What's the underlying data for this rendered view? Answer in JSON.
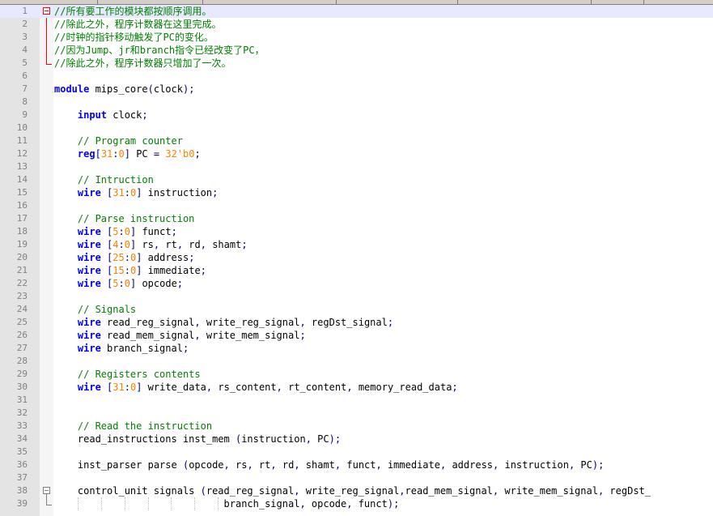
{
  "editor": {
    "fold_markers": [
      {
        "line": 1,
        "type": "minus",
        "color": "red"
      },
      {
        "line": 38,
        "type": "minus",
        "color": "gray"
      }
    ],
    "current_line": 1
  },
  "lines": [
    {
      "num": "1",
      "tokens": [
        {
          "t": "//所有要工作的模块都按顺序调用。",
          "c": "cm"
        }
      ]
    },
    {
      "num": "2",
      "tokens": [
        {
          "t": "//除此之外，程序计数器在这里完成。",
          "c": "cm"
        }
      ]
    },
    {
      "num": "3",
      "tokens": [
        {
          "t": "//时钟的指针移动触发了PC的变化。",
          "c": "cm"
        }
      ]
    },
    {
      "num": "4",
      "tokens": [
        {
          "t": "//因为Jump、jr和branch指令已经改变了PC，",
          "c": "cm"
        }
      ]
    },
    {
      "num": "5",
      "tokens": [
        {
          "t": "//除此之外，程序计数器只增加了一次。",
          "c": "cm"
        }
      ]
    },
    {
      "num": "6",
      "tokens": []
    },
    {
      "num": "7",
      "tokens": [
        {
          "t": "module",
          "c": "kw"
        },
        {
          "t": " mips_core",
          "c": ""
        },
        {
          "t": "(",
          "c": "op"
        },
        {
          "t": "clock",
          "c": ""
        },
        {
          "t": ");",
          "c": "op"
        }
      ]
    },
    {
      "num": "8",
      "tokens": []
    },
    {
      "num": "9",
      "tokens": [
        {
          "t": "    ",
          "c": ""
        },
        {
          "t": "input",
          "c": "kw"
        },
        {
          "t": " clock",
          "c": ""
        },
        {
          "t": ";",
          "c": "op"
        }
      ]
    },
    {
      "num": "10",
      "tokens": []
    },
    {
      "num": "11",
      "tokens": [
        {
          "t": "    ",
          "c": ""
        },
        {
          "t": "// Program counter",
          "c": "cm"
        }
      ]
    },
    {
      "num": "12",
      "tokens": [
        {
          "t": "    ",
          "c": ""
        },
        {
          "t": "reg",
          "c": "kw"
        },
        {
          "t": "[",
          "c": "op"
        },
        {
          "t": "31",
          "c": "num"
        },
        {
          "t": ":",
          "c": "op"
        },
        {
          "t": "0",
          "c": "num"
        },
        {
          "t": "]",
          "c": "op"
        },
        {
          "t": " PC ",
          "c": ""
        },
        {
          "t": "=",
          "c": "op"
        },
        {
          "t": " ",
          "c": ""
        },
        {
          "t": "32'b0",
          "c": "num"
        },
        {
          "t": ";",
          "c": "op"
        }
      ]
    },
    {
      "num": "13",
      "tokens": []
    },
    {
      "num": "14",
      "tokens": [
        {
          "t": "    ",
          "c": ""
        },
        {
          "t": "// Intruction",
          "c": "cm"
        }
      ]
    },
    {
      "num": "15",
      "tokens": [
        {
          "t": "    ",
          "c": ""
        },
        {
          "t": "wire",
          "c": "kw"
        },
        {
          "t": " ",
          "c": ""
        },
        {
          "t": "[",
          "c": "op"
        },
        {
          "t": "31",
          "c": "num"
        },
        {
          "t": ":",
          "c": "op"
        },
        {
          "t": "0",
          "c": "num"
        },
        {
          "t": "]",
          "c": "op"
        },
        {
          "t": " instruction",
          "c": ""
        },
        {
          "t": ";",
          "c": "op"
        }
      ]
    },
    {
      "num": "16",
      "tokens": []
    },
    {
      "num": "17",
      "tokens": [
        {
          "t": "    ",
          "c": ""
        },
        {
          "t": "// Parse instruction",
          "c": "cm"
        }
      ]
    },
    {
      "num": "18",
      "tokens": [
        {
          "t": "    ",
          "c": ""
        },
        {
          "t": "wire",
          "c": "kw"
        },
        {
          "t": " ",
          "c": ""
        },
        {
          "t": "[",
          "c": "op"
        },
        {
          "t": "5",
          "c": "num"
        },
        {
          "t": ":",
          "c": "op"
        },
        {
          "t": "0",
          "c": "num"
        },
        {
          "t": "]",
          "c": "op"
        },
        {
          "t": " funct",
          "c": ""
        },
        {
          "t": ";",
          "c": "op"
        }
      ]
    },
    {
      "num": "19",
      "tokens": [
        {
          "t": "    ",
          "c": ""
        },
        {
          "t": "wire",
          "c": "kw"
        },
        {
          "t": " ",
          "c": ""
        },
        {
          "t": "[",
          "c": "op"
        },
        {
          "t": "4",
          "c": "num"
        },
        {
          "t": ":",
          "c": "op"
        },
        {
          "t": "0",
          "c": "num"
        },
        {
          "t": "]",
          "c": "op"
        },
        {
          "t": " rs",
          "c": ""
        },
        {
          "t": ",",
          "c": "op"
        },
        {
          "t": " rt",
          "c": ""
        },
        {
          "t": ",",
          "c": "op"
        },
        {
          "t": " rd",
          "c": ""
        },
        {
          "t": ",",
          "c": "op"
        },
        {
          "t": " shamt",
          "c": ""
        },
        {
          "t": ";",
          "c": "op"
        }
      ]
    },
    {
      "num": "20",
      "tokens": [
        {
          "t": "    ",
          "c": ""
        },
        {
          "t": "wire",
          "c": "kw"
        },
        {
          "t": " ",
          "c": ""
        },
        {
          "t": "[",
          "c": "op"
        },
        {
          "t": "25",
          "c": "num"
        },
        {
          "t": ":",
          "c": "op"
        },
        {
          "t": "0",
          "c": "num"
        },
        {
          "t": "]",
          "c": "op"
        },
        {
          "t": " address",
          "c": ""
        },
        {
          "t": ";",
          "c": "op"
        }
      ]
    },
    {
      "num": "21",
      "tokens": [
        {
          "t": "    ",
          "c": ""
        },
        {
          "t": "wire",
          "c": "kw"
        },
        {
          "t": " ",
          "c": ""
        },
        {
          "t": "[",
          "c": "op"
        },
        {
          "t": "15",
          "c": "num"
        },
        {
          "t": ":",
          "c": "op"
        },
        {
          "t": "0",
          "c": "num"
        },
        {
          "t": "]",
          "c": "op"
        },
        {
          "t": " immediate",
          "c": ""
        },
        {
          "t": ";",
          "c": "op"
        }
      ]
    },
    {
      "num": "22",
      "tokens": [
        {
          "t": "    ",
          "c": ""
        },
        {
          "t": "wire",
          "c": "kw"
        },
        {
          "t": " ",
          "c": ""
        },
        {
          "t": "[",
          "c": "op"
        },
        {
          "t": "5",
          "c": "num"
        },
        {
          "t": ":",
          "c": "op"
        },
        {
          "t": "0",
          "c": "num"
        },
        {
          "t": "]",
          "c": "op"
        },
        {
          "t": " opcode",
          "c": ""
        },
        {
          "t": ";",
          "c": "op"
        }
      ]
    },
    {
      "num": "23",
      "tokens": []
    },
    {
      "num": "24",
      "tokens": [
        {
          "t": "    ",
          "c": ""
        },
        {
          "t": "// Signals",
          "c": "cm"
        }
      ]
    },
    {
      "num": "25",
      "tokens": [
        {
          "t": "    ",
          "c": ""
        },
        {
          "t": "wire",
          "c": "kw"
        },
        {
          "t": " read_reg_signal",
          "c": ""
        },
        {
          "t": ",",
          "c": "op"
        },
        {
          "t": " write_reg_signal",
          "c": ""
        },
        {
          "t": ",",
          "c": "op"
        },
        {
          "t": " regDst_signal",
          "c": ""
        },
        {
          "t": ";",
          "c": "op"
        }
      ]
    },
    {
      "num": "26",
      "tokens": [
        {
          "t": "    ",
          "c": ""
        },
        {
          "t": "wire",
          "c": "kw"
        },
        {
          "t": " read_mem_signal",
          "c": ""
        },
        {
          "t": ",",
          "c": "op"
        },
        {
          "t": " write_mem_signal",
          "c": ""
        },
        {
          "t": ";",
          "c": "op"
        }
      ]
    },
    {
      "num": "27",
      "tokens": [
        {
          "t": "    ",
          "c": ""
        },
        {
          "t": "wire",
          "c": "kw"
        },
        {
          "t": " branch_signal",
          "c": ""
        },
        {
          "t": ";",
          "c": "op"
        }
      ]
    },
    {
      "num": "28",
      "tokens": []
    },
    {
      "num": "29",
      "tokens": [
        {
          "t": "    ",
          "c": ""
        },
        {
          "t": "// Registers contents",
          "c": "cm"
        }
      ]
    },
    {
      "num": "30",
      "tokens": [
        {
          "t": "    ",
          "c": ""
        },
        {
          "t": "wire",
          "c": "kw"
        },
        {
          "t": " ",
          "c": ""
        },
        {
          "t": "[",
          "c": "op"
        },
        {
          "t": "31",
          "c": "num"
        },
        {
          "t": ":",
          "c": "op"
        },
        {
          "t": "0",
          "c": "num"
        },
        {
          "t": "]",
          "c": "op"
        },
        {
          "t": " write_data",
          "c": ""
        },
        {
          "t": ",",
          "c": "op"
        },
        {
          "t": " rs_content",
          "c": ""
        },
        {
          "t": ",",
          "c": "op"
        },
        {
          "t": " rt_content",
          "c": ""
        },
        {
          "t": ",",
          "c": "op"
        },
        {
          "t": " memory_read_data",
          "c": ""
        },
        {
          "t": ";",
          "c": "op"
        }
      ]
    },
    {
      "num": "31",
      "tokens": []
    },
    {
      "num": "32",
      "tokens": []
    },
    {
      "num": "33",
      "tokens": [
        {
          "t": "    ",
          "c": ""
        },
        {
          "t": "// Read the instruction",
          "c": "cm"
        }
      ]
    },
    {
      "num": "34",
      "tokens": [
        {
          "t": "    read_instructions inst_mem ",
          "c": ""
        },
        {
          "t": "(",
          "c": "op"
        },
        {
          "t": "instruction",
          "c": ""
        },
        {
          "t": ",",
          "c": "op"
        },
        {
          "t": " PC",
          "c": ""
        },
        {
          "t": ");",
          "c": "op"
        }
      ]
    },
    {
      "num": "35",
      "tokens": []
    },
    {
      "num": "36",
      "tokens": [
        {
          "t": "    inst_parser parse ",
          "c": ""
        },
        {
          "t": "(",
          "c": "op"
        },
        {
          "t": "opcode",
          "c": ""
        },
        {
          "t": ",",
          "c": "op"
        },
        {
          "t": " rs",
          "c": ""
        },
        {
          "t": ",",
          "c": "op"
        },
        {
          "t": " rt",
          "c": ""
        },
        {
          "t": ",",
          "c": "op"
        },
        {
          "t": " rd",
          "c": ""
        },
        {
          "t": ",",
          "c": "op"
        },
        {
          "t": " shamt",
          "c": ""
        },
        {
          "t": ",",
          "c": "op"
        },
        {
          "t": " funct",
          "c": ""
        },
        {
          "t": ",",
          "c": "op"
        },
        {
          "t": " immediate",
          "c": ""
        },
        {
          "t": ",",
          "c": "op"
        },
        {
          "t": " address",
          "c": ""
        },
        {
          "t": ",",
          "c": "op"
        },
        {
          "t": " instruction",
          "c": ""
        },
        {
          "t": ",",
          "c": "op"
        },
        {
          "t": " PC",
          "c": ""
        },
        {
          "t": ");",
          "c": "op"
        }
      ]
    },
    {
      "num": "37",
      "tokens": []
    },
    {
      "num": "38",
      "tokens": [
        {
          "t": "    control_unit signals ",
          "c": ""
        },
        {
          "t": "(",
          "c": "op"
        },
        {
          "t": "read_reg_signal",
          "c": ""
        },
        {
          "t": ",",
          "c": "op"
        },
        {
          "t": " write_reg_signal",
          "c": ""
        },
        {
          "t": ",",
          "c": "op"
        },
        {
          "t": "read_mem_signal",
          "c": ""
        },
        {
          "t": ",",
          "c": "op"
        },
        {
          "t": " write_mem_signal",
          "c": ""
        },
        {
          "t": ",",
          "c": "op"
        },
        {
          "t": " regDst_",
          "c": ""
        }
      ]
    },
    {
      "num": "39",
      "tokens": [
        {
          "t": "                             branch_signal",
          "c": ""
        },
        {
          "t": ",",
          "c": "op"
        },
        {
          "t": " opcode",
          "c": ""
        },
        {
          "t": ",",
          "c": "op"
        },
        {
          "t": " funct",
          "c": ""
        },
        {
          "t": ");",
          "c": "op"
        }
      ]
    }
  ]
}
